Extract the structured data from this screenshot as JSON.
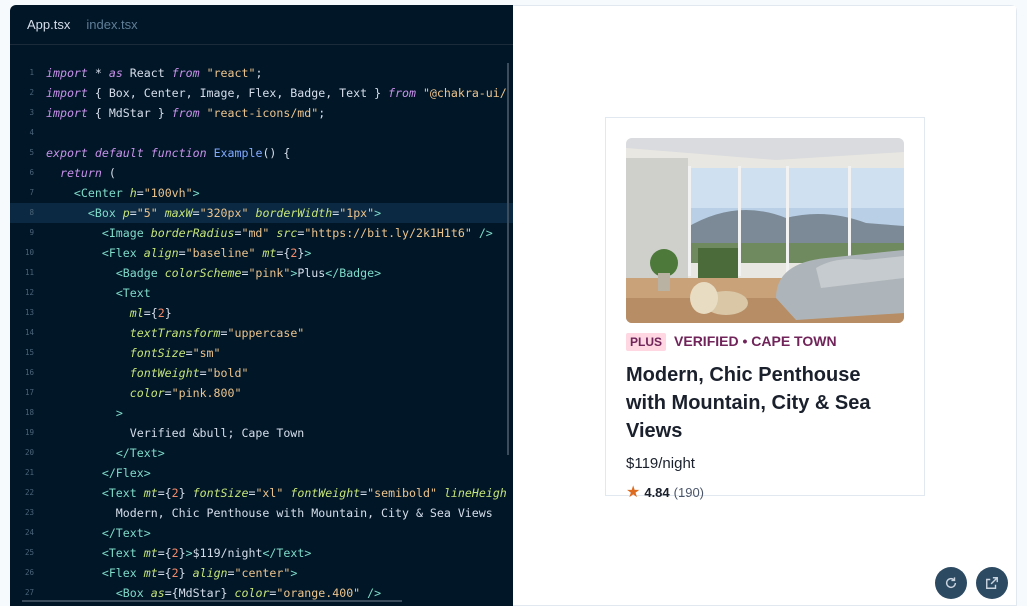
{
  "editor": {
    "tabs": [
      {
        "label": "App.tsx",
        "active": true
      },
      {
        "label": "index.tsx",
        "active": false
      }
    ],
    "highlighted_line": 8,
    "lines": [
      [
        [
          "kw",
          "import"
        ],
        [
          "plain",
          " * "
        ],
        [
          "kw",
          "as"
        ],
        [
          "plain",
          " React "
        ],
        [
          "kw",
          "from"
        ],
        [
          "plain",
          " "
        ],
        [
          "str",
          "\"react\""
        ],
        [
          "plain",
          ";"
        ]
      ],
      [
        [
          "kw",
          "import"
        ],
        [
          "plain",
          " { Box, Center, Image, Flex, Badge, Text } "
        ],
        [
          "kw",
          "from"
        ],
        [
          "plain",
          " "
        ],
        [
          "str",
          "\"@chakra-ui/"
        ]
      ],
      [
        [
          "kw",
          "import"
        ],
        [
          "plain",
          " { MdStar } "
        ],
        [
          "kw",
          "from"
        ],
        [
          "plain",
          " "
        ],
        [
          "str",
          "\"react-icons/md\""
        ],
        [
          "plain",
          ";"
        ]
      ],
      [],
      [
        [
          "kw",
          "export"
        ],
        [
          "plain",
          " "
        ],
        [
          "kw",
          "default"
        ],
        [
          "plain",
          " "
        ],
        [
          "kw",
          "function"
        ],
        [
          "plain",
          " "
        ],
        [
          "fn",
          "Example"
        ],
        [
          "plain",
          "() {"
        ]
      ],
      [
        [
          "plain",
          "  "
        ],
        [
          "kw",
          "return"
        ],
        [
          "plain",
          " ("
        ]
      ],
      [
        [
          "plain",
          "    "
        ],
        [
          "tag",
          "<Center"
        ],
        [
          "plain",
          " "
        ],
        [
          "attr",
          "h"
        ],
        [
          "plain",
          "="
        ],
        [
          "str",
          "\"100vh\""
        ],
        [
          "tag",
          ">"
        ]
      ],
      [
        [
          "plain",
          "      "
        ],
        [
          "tag",
          "<Box"
        ],
        [
          "plain",
          " "
        ],
        [
          "attr",
          "p"
        ],
        [
          "plain",
          "="
        ],
        [
          "str",
          "\"5\""
        ],
        [
          "plain",
          " "
        ],
        [
          "attr",
          "maxW"
        ],
        [
          "plain",
          "="
        ],
        [
          "str",
          "\"320px\""
        ],
        [
          "plain",
          " "
        ],
        [
          "attr",
          "borderWidth"
        ],
        [
          "plain",
          "="
        ],
        [
          "str",
          "\"1px\""
        ],
        [
          "tag",
          ">"
        ]
      ],
      [
        [
          "plain",
          "        "
        ],
        [
          "tag",
          "<Image"
        ],
        [
          "plain",
          " "
        ],
        [
          "attr",
          "borderRadius"
        ],
        [
          "plain",
          "="
        ],
        [
          "str",
          "\"md\""
        ],
        [
          "plain",
          " "
        ],
        [
          "attr",
          "src"
        ],
        [
          "plain",
          "="
        ],
        [
          "str",
          "\"https://bit.ly/2k1H1t6\""
        ],
        [
          "plain",
          " "
        ],
        [
          "tag",
          "/>"
        ]
      ],
      [
        [
          "plain",
          "        "
        ],
        [
          "tag",
          "<Flex"
        ],
        [
          "plain",
          " "
        ],
        [
          "attr",
          "align"
        ],
        [
          "plain",
          "="
        ],
        [
          "str",
          "\"baseline\""
        ],
        [
          "plain",
          " "
        ],
        [
          "attr",
          "mt"
        ],
        [
          "plain",
          "={"
        ],
        [
          "num",
          "2"
        ],
        [
          "plain",
          "}"
        ],
        [
          "tag",
          ">"
        ]
      ],
      [
        [
          "plain",
          "          "
        ],
        [
          "tag",
          "<Badge"
        ],
        [
          "plain",
          " "
        ],
        [
          "attr",
          "colorScheme"
        ],
        [
          "plain",
          "="
        ],
        [
          "str",
          "\"pink\""
        ],
        [
          "tag",
          ">"
        ],
        [
          "plain",
          "Plus"
        ],
        [
          "tag",
          "</Badge>"
        ]
      ],
      [
        [
          "plain",
          "          "
        ],
        [
          "tag",
          "<Text"
        ]
      ],
      [
        [
          "plain",
          "            "
        ],
        [
          "attr",
          "ml"
        ],
        [
          "plain",
          "={"
        ],
        [
          "num",
          "2"
        ],
        [
          "plain",
          "}"
        ]
      ],
      [
        [
          "plain",
          "            "
        ],
        [
          "attr",
          "textTransform"
        ],
        [
          "plain",
          "="
        ],
        [
          "str",
          "\"uppercase\""
        ]
      ],
      [
        [
          "plain",
          "            "
        ],
        [
          "attr",
          "fontSize"
        ],
        [
          "plain",
          "="
        ],
        [
          "str",
          "\"sm\""
        ]
      ],
      [
        [
          "plain",
          "            "
        ],
        [
          "attr",
          "fontWeight"
        ],
        [
          "plain",
          "="
        ],
        [
          "str",
          "\"bold\""
        ]
      ],
      [
        [
          "plain",
          "            "
        ],
        [
          "attr",
          "color"
        ],
        [
          "plain",
          "="
        ],
        [
          "str",
          "\"pink.800\""
        ]
      ],
      [
        [
          "plain",
          "          "
        ],
        [
          "tag",
          ">"
        ]
      ],
      [
        [
          "plain",
          "            Verified &bull; Cape Town"
        ]
      ],
      [
        [
          "plain",
          "          "
        ],
        [
          "tag",
          "</Text>"
        ]
      ],
      [
        [
          "plain",
          "        "
        ],
        [
          "tag",
          "</Flex>"
        ]
      ],
      [
        [
          "plain",
          "        "
        ],
        [
          "tag",
          "<Text"
        ],
        [
          "plain",
          " "
        ],
        [
          "attr",
          "mt"
        ],
        [
          "plain",
          "={"
        ],
        [
          "num",
          "2"
        ],
        [
          "plain",
          "} "
        ],
        [
          "attr",
          "fontSize"
        ],
        [
          "plain",
          "="
        ],
        [
          "str",
          "\"xl\""
        ],
        [
          "plain",
          " "
        ],
        [
          "attr",
          "fontWeight"
        ],
        [
          "plain",
          "="
        ],
        [
          "str",
          "\"semibold\""
        ],
        [
          "plain",
          " "
        ],
        [
          "attr",
          "lineHeigh"
        ]
      ],
      [
        [
          "plain",
          "          Modern, Chic Penthouse with Mountain, City & Sea Views"
        ]
      ],
      [
        [
          "plain",
          "        "
        ],
        [
          "tag",
          "</Text>"
        ]
      ],
      [
        [
          "plain",
          "        "
        ],
        [
          "tag",
          "<Text"
        ],
        [
          "plain",
          " "
        ],
        [
          "attr",
          "mt"
        ],
        [
          "plain",
          "={"
        ],
        [
          "num",
          "2"
        ],
        [
          "plain",
          "}"
        ],
        [
          "tag",
          ">"
        ],
        [
          "plain",
          "$119/night"
        ],
        [
          "tag",
          "</Text>"
        ]
      ],
      [
        [
          "plain",
          "        "
        ],
        [
          "tag",
          "<Flex"
        ],
        [
          "plain",
          " "
        ],
        [
          "attr",
          "mt"
        ],
        [
          "plain",
          "={"
        ],
        [
          "num",
          "2"
        ],
        [
          "plain",
          "} "
        ],
        [
          "attr",
          "align"
        ],
        [
          "plain",
          "="
        ],
        [
          "str",
          "\"center\""
        ],
        [
          "tag",
          ">"
        ]
      ],
      [
        [
          "plain",
          "          "
        ],
        [
          "tag",
          "<Box"
        ],
        [
          "plain",
          " "
        ],
        [
          "attr",
          "as"
        ],
        [
          "plain",
          "={MdStar} "
        ],
        [
          "attr",
          "color"
        ],
        [
          "plain",
          "="
        ],
        [
          "str",
          "\"orange.400\""
        ],
        [
          "plain",
          " "
        ],
        [
          "tag",
          "/>"
        ]
      ]
    ]
  },
  "preview": {
    "card": {
      "badge": "Plus",
      "location": "Verified • Cape Town",
      "title": "Modern, Chic Penthouse with Mountain, City & Sea Views",
      "price": "$119/night",
      "rating": "4.84",
      "review_count": "(190)",
      "star_icon": "star-icon",
      "star_color": "#dd6b20"
    },
    "buttons": [
      {
        "icon": "refresh-icon"
      },
      {
        "icon": "external-link-icon"
      }
    ]
  },
  "colors": {
    "editor_bg": "#011627",
    "badge_bg": "#fed7e2",
    "badge_text": "#702459"
  }
}
